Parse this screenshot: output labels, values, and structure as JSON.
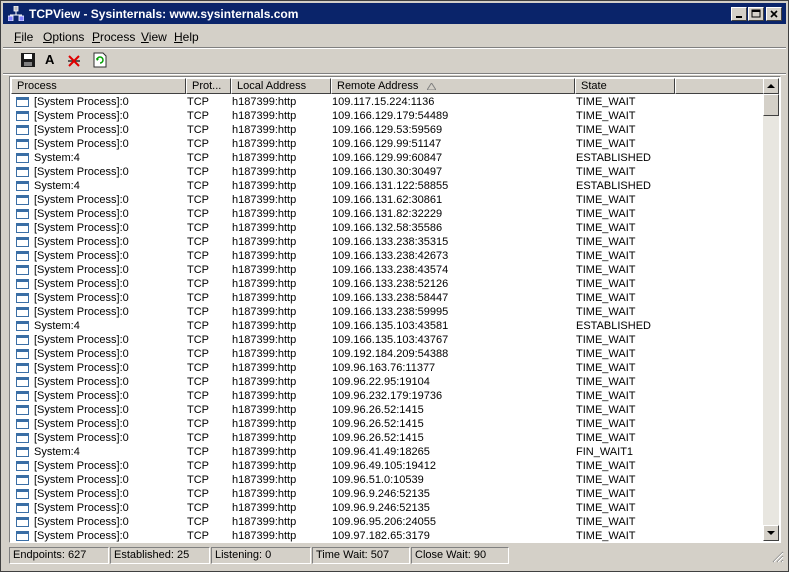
{
  "window": {
    "title": "TCPView - Sysinternals: www.sysinternals.com"
  },
  "menu": [
    {
      "label": "File",
      "accel": "F",
      "rest": "ile"
    },
    {
      "label": "Options",
      "accel": "O",
      "rest": "ptions"
    },
    {
      "label": "Process",
      "accel": "P",
      "rest": "rocess"
    },
    {
      "label": "View",
      "accel": "V",
      "rest": "iew"
    },
    {
      "label": "Help",
      "accel": "H",
      "rest": "elp"
    }
  ],
  "toolbar": {
    "font_label": "A"
  },
  "columns": [
    "Process",
    "Prot...",
    "Local Address",
    "Remote Address",
    "State"
  ],
  "rows": [
    {
      "process": "[System Process]:0",
      "protocol": "TCP",
      "local": "h187399:http",
      "remote": "109.117.15.224:1136",
      "state": "TIME_WAIT"
    },
    {
      "process": "[System Process]:0",
      "protocol": "TCP",
      "local": "h187399:http",
      "remote": "109.166.129.179:54489",
      "state": "TIME_WAIT"
    },
    {
      "process": "[System Process]:0",
      "protocol": "TCP",
      "local": "h187399:http",
      "remote": "109.166.129.53:59569",
      "state": "TIME_WAIT"
    },
    {
      "process": "[System Process]:0",
      "protocol": "TCP",
      "local": "h187399:http",
      "remote": "109.166.129.99:51147",
      "state": "TIME_WAIT"
    },
    {
      "process": "System:4",
      "protocol": "TCP",
      "local": "h187399:http",
      "remote": "109.166.129.99:60847",
      "state": "ESTABLISHED"
    },
    {
      "process": "[System Process]:0",
      "protocol": "TCP",
      "local": "h187399:http",
      "remote": "109.166.130.30:30497",
      "state": "TIME_WAIT"
    },
    {
      "process": "System:4",
      "protocol": "TCP",
      "local": "h187399:http",
      "remote": "109.166.131.122:58855",
      "state": "ESTABLISHED"
    },
    {
      "process": "[System Process]:0",
      "protocol": "TCP",
      "local": "h187399:http",
      "remote": "109.166.131.62:30861",
      "state": "TIME_WAIT"
    },
    {
      "process": "[System Process]:0",
      "protocol": "TCP",
      "local": "h187399:http",
      "remote": "109.166.131.82:32229",
      "state": "TIME_WAIT"
    },
    {
      "process": "[System Process]:0",
      "protocol": "TCP",
      "local": "h187399:http",
      "remote": "109.166.132.58:35586",
      "state": "TIME_WAIT"
    },
    {
      "process": "[System Process]:0",
      "protocol": "TCP",
      "local": "h187399:http",
      "remote": "109.166.133.238:35315",
      "state": "TIME_WAIT"
    },
    {
      "process": "[System Process]:0",
      "protocol": "TCP",
      "local": "h187399:http",
      "remote": "109.166.133.238:42673",
      "state": "TIME_WAIT"
    },
    {
      "process": "[System Process]:0",
      "protocol": "TCP",
      "local": "h187399:http",
      "remote": "109.166.133.238:43574",
      "state": "TIME_WAIT"
    },
    {
      "process": "[System Process]:0",
      "protocol": "TCP",
      "local": "h187399:http",
      "remote": "109.166.133.238:52126",
      "state": "TIME_WAIT"
    },
    {
      "process": "[System Process]:0",
      "protocol": "TCP",
      "local": "h187399:http",
      "remote": "109.166.133.238:58447",
      "state": "TIME_WAIT"
    },
    {
      "process": "[System Process]:0",
      "protocol": "TCP",
      "local": "h187399:http",
      "remote": "109.166.133.238:59995",
      "state": "TIME_WAIT"
    },
    {
      "process": "System:4",
      "protocol": "TCP",
      "local": "h187399:http",
      "remote": "109.166.135.103:43581",
      "state": "ESTABLISHED"
    },
    {
      "process": "[System Process]:0",
      "protocol": "TCP",
      "local": "h187399:http",
      "remote": "109.166.135.103:43767",
      "state": "TIME_WAIT"
    },
    {
      "process": "[System Process]:0",
      "protocol": "TCP",
      "local": "h187399:http",
      "remote": "109.192.184.209:54388",
      "state": "TIME_WAIT"
    },
    {
      "process": "[System Process]:0",
      "protocol": "TCP",
      "local": "h187399:http",
      "remote": "109.96.163.76:11377",
      "state": "TIME_WAIT"
    },
    {
      "process": "[System Process]:0",
      "protocol": "TCP",
      "local": "h187399:http",
      "remote": "109.96.22.95:19104",
      "state": "TIME_WAIT"
    },
    {
      "process": "[System Process]:0",
      "protocol": "TCP",
      "local": "h187399:http",
      "remote": "109.96.232.179:19736",
      "state": "TIME_WAIT"
    },
    {
      "process": "[System Process]:0",
      "protocol": "TCP",
      "local": "h187399:http",
      "remote": "109.96.26.52:1415",
      "state": "TIME_WAIT"
    },
    {
      "process": "[System Process]:0",
      "protocol": "TCP",
      "local": "h187399:http",
      "remote": "109.96.26.52:1415",
      "state": "TIME_WAIT"
    },
    {
      "process": "[System Process]:0",
      "protocol": "TCP",
      "local": "h187399:http",
      "remote": "109.96.26.52:1415",
      "state": "TIME_WAIT"
    },
    {
      "process": "System:4",
      "protocol": "TCP",
      "local": "h187399:http",
      "remote": "109.96.41.49:18265",
      "state": "FIN_WAIT1"
    },
    {
      "process": "[System Process]:0",
      "protocol": "TCP",
      "local": "h187399:http",
      "remote": "109.96.49.105:19412",
      "state": "TIME_WAIT"
    },
    {
      "process": "[System Process]:0",
      "protocol": "TCP",
      "local": "h187399:http",
      "remote": "109.96.51.0:10539",
      "state": "TIME_WAIT"
    },
    {
      "process": "[System Process]:0",
      "protocol": "TCP",
      "local": "h187399:http",
      "remote": "109.96.9.246:52135",
      "state": "TIME_WAIT"
    },
    {
      "process": "[System Process]:0",
      "protocol": "TCP",
      "local": "h187399:http",
      "remote": "109.96.9.246:52135",
      "state": "TIME_WAIT"
    },
    {
      "process": "[System Process]:0",
      "protocol": "TCP",
      "local": "h187399:http",
      "remote": "109.96.95.206:24055",
      "state": "TIME_WAIT"
    },
    {
      "process": "[System Process]:0",
      "protocol": "TCP",
      "local": "h187399:http",
      "remote": "109.97.182.65:3179",
      "state": "TIME_WAIT"
    }
  ],
  "status": {
    "endpoints": "Endpoints: 627",
    "established": "Established: 25",
    "listening": "Listening: 0",
    "time_wait": "Time Wait: 507",
    "close_wait": "Close Wait: 90"
  },
  "icons": {
    "app": "network-icon",
    "save": "save-icon",
    "font": "font-icon",
    "close_connection": "close-connection-icon",
    "refresh": "refresh-icon",
    "sort": "sort-ascending-icon"
  },
  "colors": {
    "titlebar": "#0a246a",
    "face": "#d4d0c8",
    "icon_border": "#3a6ea5"
  }
}
